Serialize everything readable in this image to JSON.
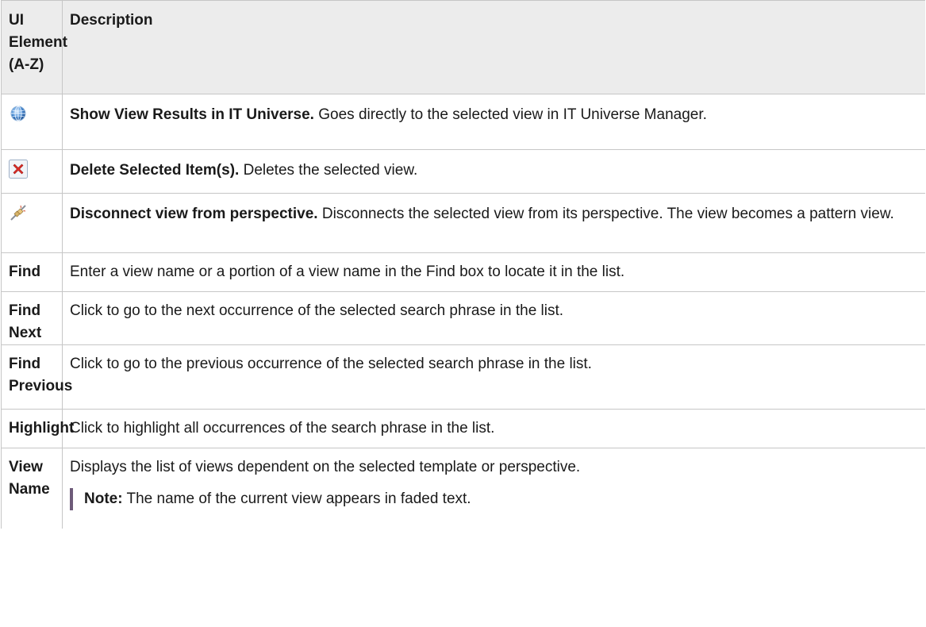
{
  "headers": {
    "col1": "UI Element (A-Z)",
    "col2": "Description"
  },
  "rows": [
    {
      "icon": "globe-icon",
      "title": "Show View Results in IT Universe.",
      "text": " Goes directly to the selected view in IT Universe Manager."
    },
    {
      "icon": "delete-x-icon",
      "title": "Delete Selected Item(s).",
      "text": " Deletes the selected view."
    },
    {
      "icon": "disconnect-icon",
      "title": "Disconnect view from perspective.",
      "text": " Disconnects the selected view from its perspective. The view becomes a pattern view."
    },
    {
      "label": "Find",
      "text": "Enter a view name or a portion of a view name in the Find box to locate it in the list."
    },
    {
      "label": "Find Next",
      "text": "Click to go to the next occurrence of the selected search phrase in the list."
    },
    {
      "label": "Find Previous",
      "text": "Click to go to the previous occurrence of the selected search phrase in the list."
    },
    {
      "label": "Highlight",
      "text": "Click to highlight all occurrences of the search phrase in the list."
    },
    {
      "label": "View Name",
      "text": "Displays the list of views dependent on the selected template or perspective.",
      "note_label": "Note:",
      "note_text": " The name of the current view appears in faded text."
    }
  ],
  "colors": {
    "header_bg": "#ececec",
    "border": "#c6c6c6",
    "note_bar": "#6e5b79"
  }
}
